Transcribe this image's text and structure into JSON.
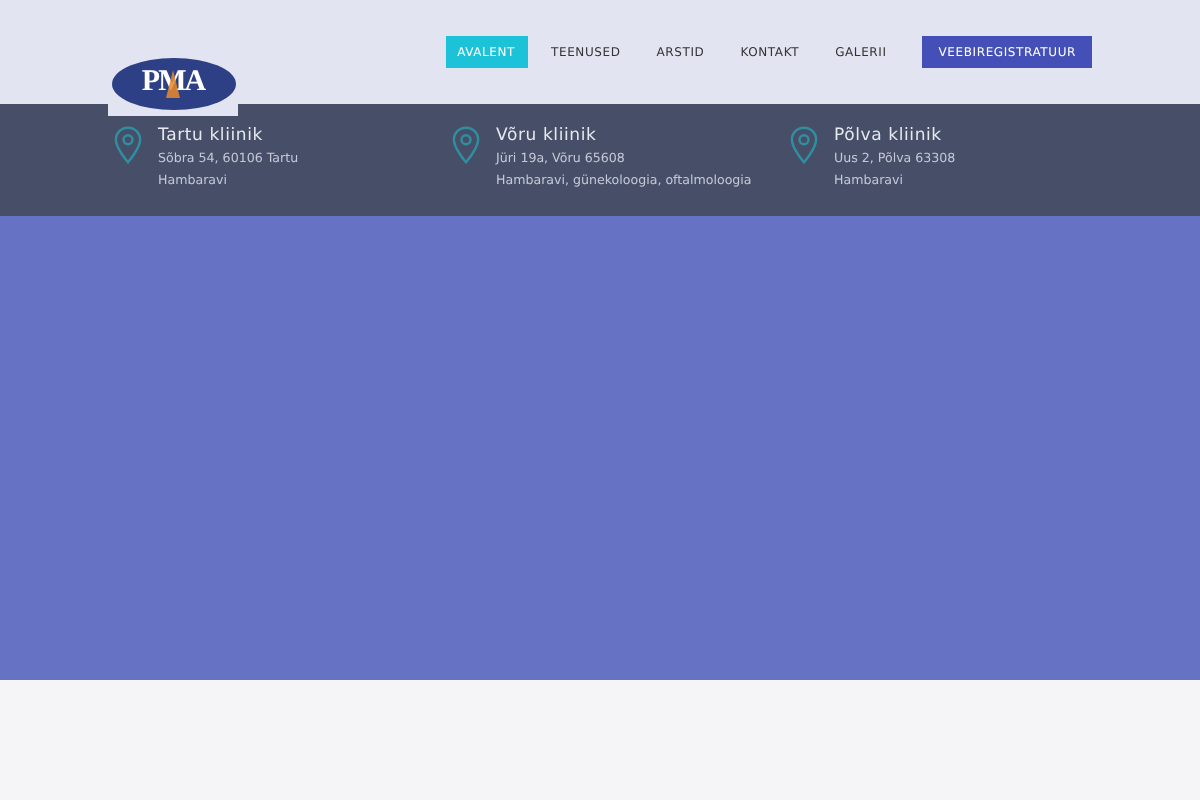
{
  "logo": {
    "text": "PMA"
  },
  "nav": [
    {
      "label": "AVALENT",
      "selected": true,
      "kind": "link"
    },
    {
      "label": "TEENUSED",
      "selected": false,
      "kind": "link"
    },
    {
      "label": "ARSTID",
      "selected": false,
      "kind": "link"
    },
    {
      "label": "KONTAKT",
      "selected": false,
      "kind": "link"
    },
    {
      "label": "GALERII",
      "selected": false,
      "kind": "link"
    },
    {
      "label": "VEEBIREGISTRATUUR",
      "selected": false,
      "kind": "cta"
    }
  ],
  "clinics": [
    {
      "name": "Tartu kliinik",
      "address": "Sõbra 54, 60106 Tartu",
      "services": "Hambaravi"
    },
    {
      "name": "Võru kliinik",
      "address": "Jüri 19a, Võru 65608",
      "services": "Hambaravi, günekoloogia, oftalmoloogia"
    },
    {
      "name": "Põlva kliinik",
      "address": "Uus 2, Põlva 63308",
      "services": "Hambaravi"
    }
  ]
}
